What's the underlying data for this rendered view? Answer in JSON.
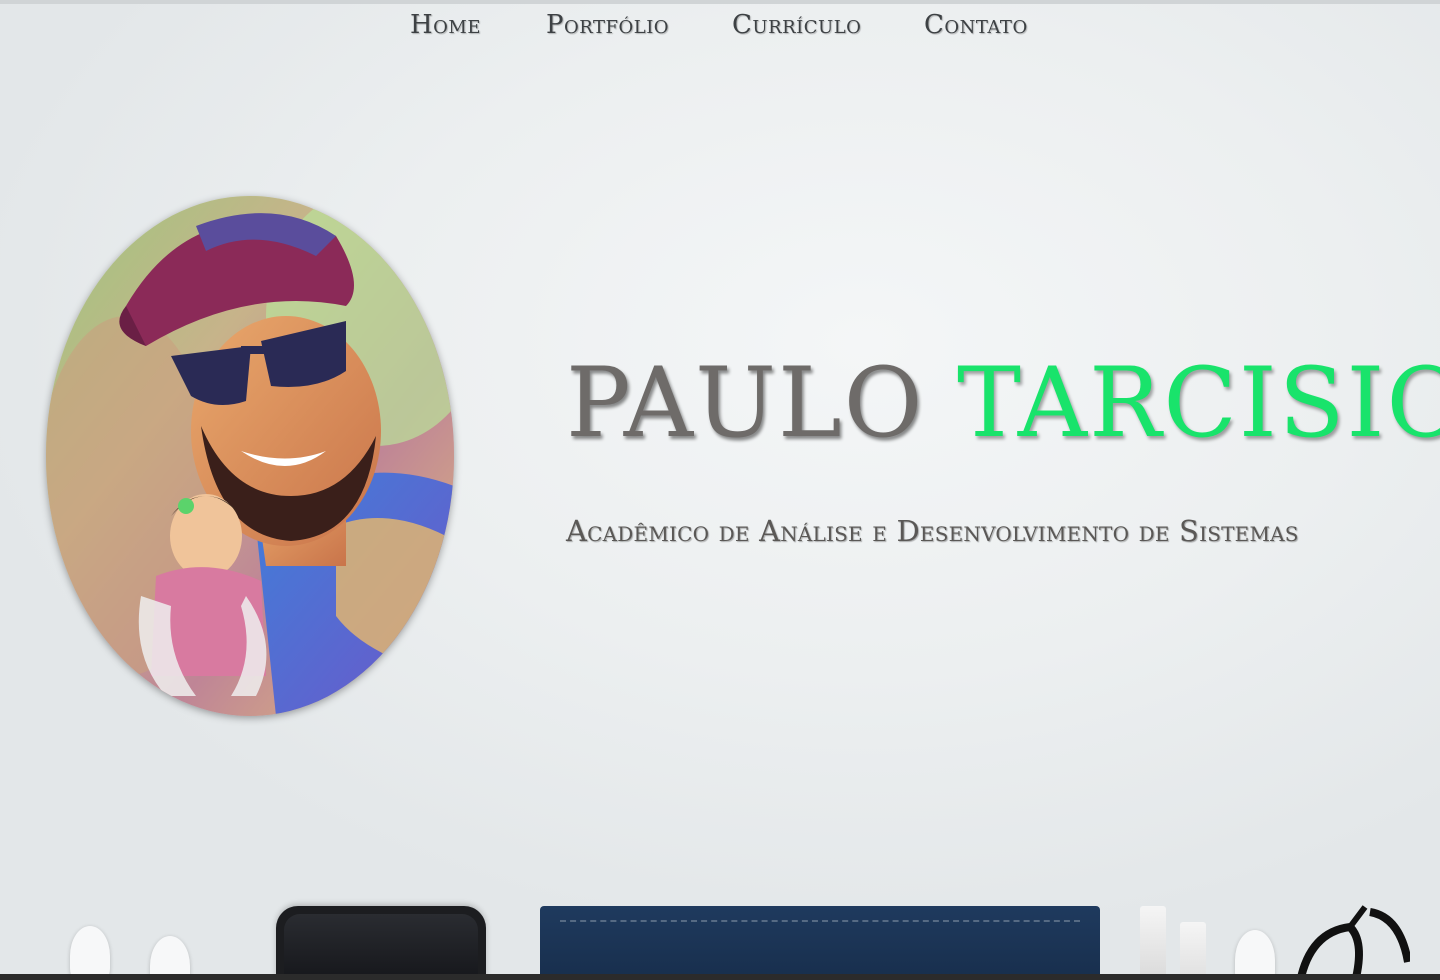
{
  "nav": {
    "items": [
      {
        "label": "Home"
      },
      {
        "label": "Portfólio"
      },
      {
        "label": "Currículo"
      },
      {
        "label": "Contato"
      }
    ]
  },
  "hero": {
    "first_name": "PAULO",
    "last_name": "TARCISIO",
    "subtitle": "Acadêmico de Análise e Desenvolvimento de Sistemas"
  },
  "colors": {
    "accent": "#19e36b",
    "name_gray": "#6e6b69",
    "background": "#eceff1"
  },
  "images": {
    "avatar": "profile-photo-icon"
  }
}
